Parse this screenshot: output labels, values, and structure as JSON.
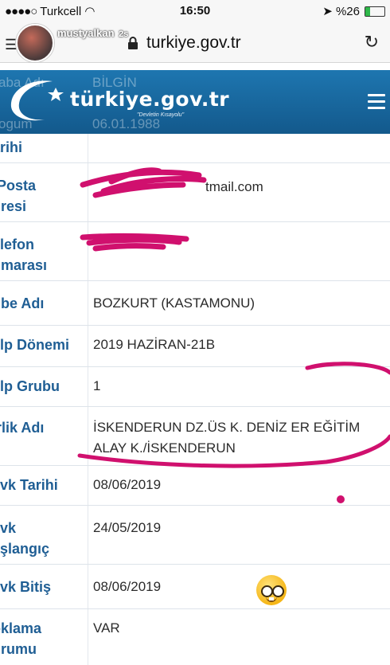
{
  "status_bar": {
    "signal": "●●●●○",
    "carrier": "Turkcell",
    "time": "16:50",
    "battery": "%26",
    "battery_level": 0.26
  },
  "browser": {
    "url": "turkiye.gov.tr",
    "username": "mustyalkan",
    "username_suffix": "2s"
  },
  "site": {
    "logo_text": "türkiye.gov.tr",
    "tagline": "\"Devletin Kısayolu\""
  },
  "header_overlay": {
    "row1_label": "aba Adı",
    "row1_value": "BİLGİN",
    "row2_label": "ogum",
    "row2_value": "06.01.1988"
  },
  "rows": [
    {
      "label": "arihi",
      "value": ""
    },
    {
      "label": "-Posta",
      "label2": "dresi",
      "value": "tmail.com"
    },
    {
      "label": "elefon",
      "label2": "umarası",
      "value": ""
    },
    {
      "label": "ube Adı",
      "value": "BOZKURT (KASTAMONU)"
    },
    {
      "label": "elp Dönemi",
      "value": "2019 HAZİRAN-21B"
    },
    {
      "label": "elp Grubu",
      "value": "1"
    },
    {
      "label": "irlik Adı",
      "value": "İSKENDERUN DZ.ÜS K. DENİZ ER EĞİTİM",
      "value2": "ALAY K./İSKENDERUN"
    },
    {
      "label": "evk Tarihi",
      "value": "08/06/2019"
    },
    {
      "label": "evk",
      "label2": "aşlangıç",
      "value": "24/05/2019"
    },
    {
      "label": "evk Bitiş",
      "value": "08/06/2019"
    },
    {
      "label": "oklama",
      "label2": "urumu",
      "value": "VAR"
    }
  ],
  "colors": {
    "header_blue": "#1b6aa5",
    "label_blue": "#1f5e94",
    "annotation_pink": "#d0106e"
  }
}
